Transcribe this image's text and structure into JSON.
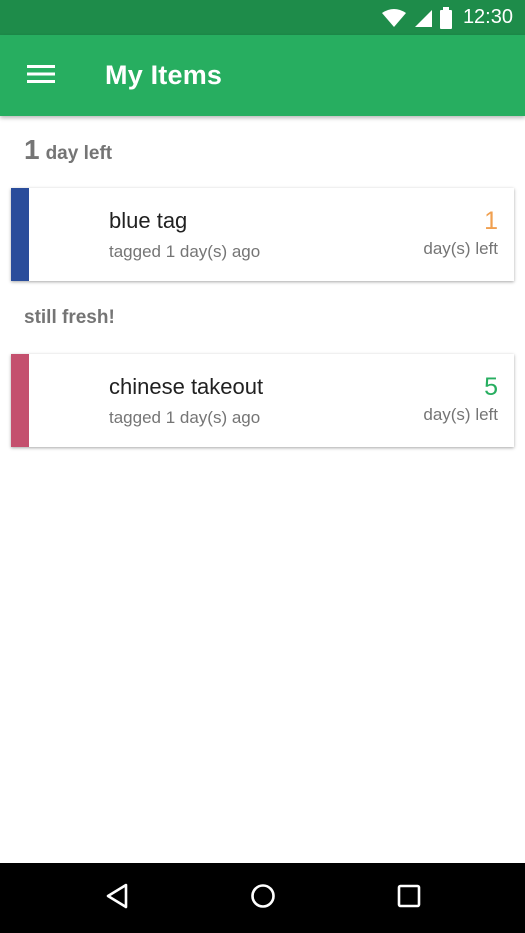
{
  "status_bar": {
    "time": "12:30",
    "icons": [
      "wifi-icon",
      "cell-signal-icon",
      "battery-icon"
    ]
  },
  "app_bar": {
    "title": "My Items",
    "menu_icon": "hamburger-menu-icon",
    "color": "#27ae60",
    "status_color": "#1e8c4a"
  },
  "sections": [
    {
      "header_number": "1",
      "header_text": "day left",
      "items": [
        {
          "name": "blue tag",
          "subtitle": "tagged 1 day(s) ago",
          "days": "1",
          "days_label": "day(s) left",
          "stripe_color": "#2a4d9b",
          "days_color": "#f0a050"
        }
      ]
    },
    {
      "header_text": "still fresh!",
      "items": [
        {
          "name": "chinese takeout",
          "subtitle": "tagged 1 day(s) ago",
          "days": "5",
          "days_label": "day(s) left",
          "stripe_color": "#c4506e",
          "days_color": "#27ae60"
        }
      ]
    }
  ],
  "nav_bar": {
    "buttons": [
      "back-icon",
      "home-icon",
      "recents-icon"
    ]
  }
}
